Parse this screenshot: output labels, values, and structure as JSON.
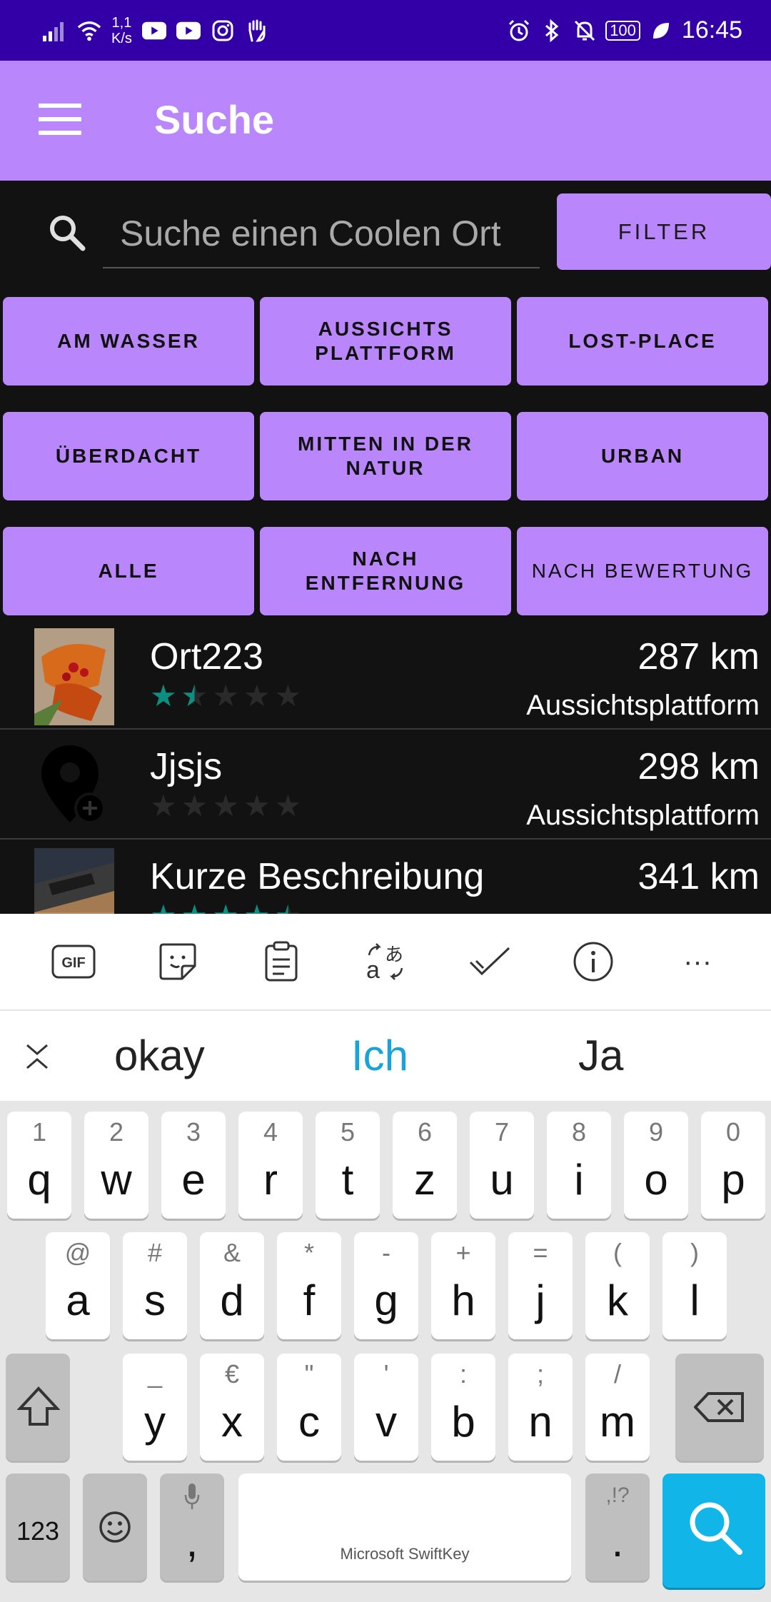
{
  "status_bar": {
    "speed_top": "1,1",
    "speed_bottom": "K/s",
    "battery": "100",
    "time": "16:45"
  },
  "app_bar": {
    "title": "Suche"
  },
  "search": {
    "placeholder": "Suche einen Coolen Ort",
    "filter_label": "FILTER"
  },
  "categories": [
    [
      "AM WASSER",
      "AUSSICHTS PLATTFORM",
      "LOST-PLACE"
    ],
    [
      "ÜBERDACHT",
      "MITTEN IN DER NATUR",
      "URBAN"
    ],
    [
      "ALLE",
      "NACH ENTFERNUNG",
      "NACH BEWERTUNG"
    ]
  ],
  "places": [
    {
      "name": "Ort223",
      "distance": "287 km",
      "category": "Aussichtsplattform",
      "rating": 1.5
    },
    {
      "name": "Jjsjs",
      "distance": "298 km",
      "category": "Aussichtsplattform",
      "rating": 0
    },
    {
      "name": "Kurze Beschreibung",
      "distance": "341 km",
      "category": "",
      "rating": 4.5
    }
  ],
  "keyboard": {
    "toolbar_icons": [
      "gif-icon",
      "sticker-icon",
      "clipboard-icon",
      "translate-icon",
      "checkmark-icon",
      "info-icon",
      "more-icon"
    ],
    "gif_label": "GIF",
    "more_label": "···",
    "suggestions": [
      "okay",
      "Ich",
      "Ja"
    ],
    "row1": [
      [
        "1",
        "q"
      ],
      [
        "2",
        "w"
      ],
      [
        "3",
        "e"
      ],
      [
        "4",
        "r"
      ],
      [
        "5",
        "t"
      ],
      [
        "6",
        "z"
      ],
      [
        "7",
        "u"
      ],
      [
        "8",
        "i"
      ],
      [
        "9",
        "o"
      ],
      [
        "0",
        "p"
      ]
    ],
    "row2": [
      [
        "@",
        "a"
      ],
      [
        "#",
        "s"
      ],
      [
        "&",
        "d"
      ],
      [
        "*",
        "f"
      ],
      [
        "-",
        "g"
      ],
      [
        "+",
        "h"
      ],
      [
        "=",
        "j"
      ],
      [
        "(",
        "k"
      ],
      [
        ")",
        "l"
      ]
    ],
    "row3": [
      [
        "_",
        "y"
      ],
      [
        "€",
        "x"
      ],
      [
        "\"",
        "c"
      ],
      [
        "'",
        "v"
      ],
      [
        ":",
        "b"
      ],
      [
        ";",
        "n"
      ],
      [
        "/",
        "m"
      ]
    ],
    "num_key": "123",
    "comma_key": ",",
    "period_sub": ",!?",
    "period_key": ".",
    "space_label": "Microsoft SwiftKey"
  }
}
